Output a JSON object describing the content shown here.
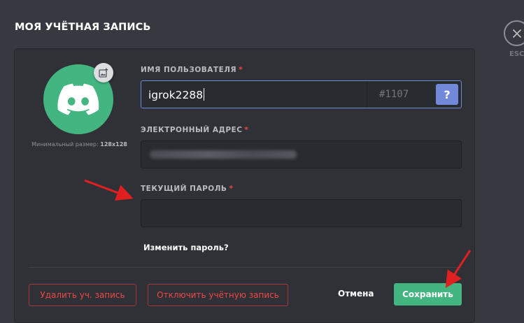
{
  "header": {
    "title": "МОЯ УЧЁТНАЯ ЗАПИСЬ",
    "close_hint": "ESC"
  },
  "avatar": {
    "icon": "discord-logo-icon",
    "upload_icon": "image-add-icon",
    "hint_prefix": "Минимальный размер:",
    "hint_size": "128x128",
    "bg_color": "#43b581"
  },
  "fields": {
    "username": {
      "label": "ИМЯ ПОЛЬЗОВАТЕЛЯ",
      "required": "*",
      "value": "igrok2288",
      "tag": "#1107",
      "help": "?"
    },
    "email": {
      "label": "ЭЛЕКТРОННЫЙ АДРЕС",
      "required": "*"
    },
    "password": {
      "label": "ТЕКУЩИЙ ПАРОЛЬ",
      "required": "*",
      "value": ""
    },
    "change_password_link": "Изменить пароль?"
  },
  "footer": {
    "delete_label": "Удалить уч. запись",
    "disable_label": "Отключить учётную запись",
    "cancel_label": "Отмена",
    "save_label": "Сохранить"
  },
  "colors": {
    "background": "#36393f",
    "card": "#2f3136",
    "accent": "#7289da",
    "success": "#43b581",
    "danger": "#f04747",
    "annotation_arrow": "#e02020"
  }
}
